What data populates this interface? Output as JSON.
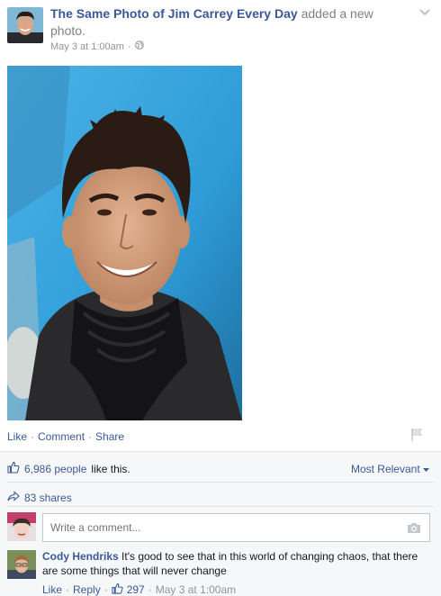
{
  "post": {
    "page_name": "The Same Photo of Jim Carrey Every Day",
    "action_text": "added a new photo.",
    "timestamp": "May 3 at 1:00am",
    "privacy_icon": "globe-icon",
    "options_icon": "chevron-down-icon"
  },
  "actions": {
    "like": "Like",
    "comment": "Comment",
    "share": "Share",
    "separator": "·"
  },
  "feedback": {
    "likes_count": "6,986 people",
    "likes_suffix": "like this.",
    "sort_label": "Most Relevant",
    "shares": "83 shares"
  },
  "composer": {
    "placeholder": "Write a comment..."
  },
  "comment": {
    "author": "Cody Hendriks",
    "text": "It's good to see that in this world of changing chaos, that there are some things that will never change",
    "like": "Like",
    "reply": "Reply",
    "like_count": "297",
    "timestamp": "May 3 at 1:00am",
    "separator": "·"
  },
  "colors": {
    "link": "#3b5998",
    "muted": "#90949c",
    "feedback_bg": "#f6f7f9"
  }
}
